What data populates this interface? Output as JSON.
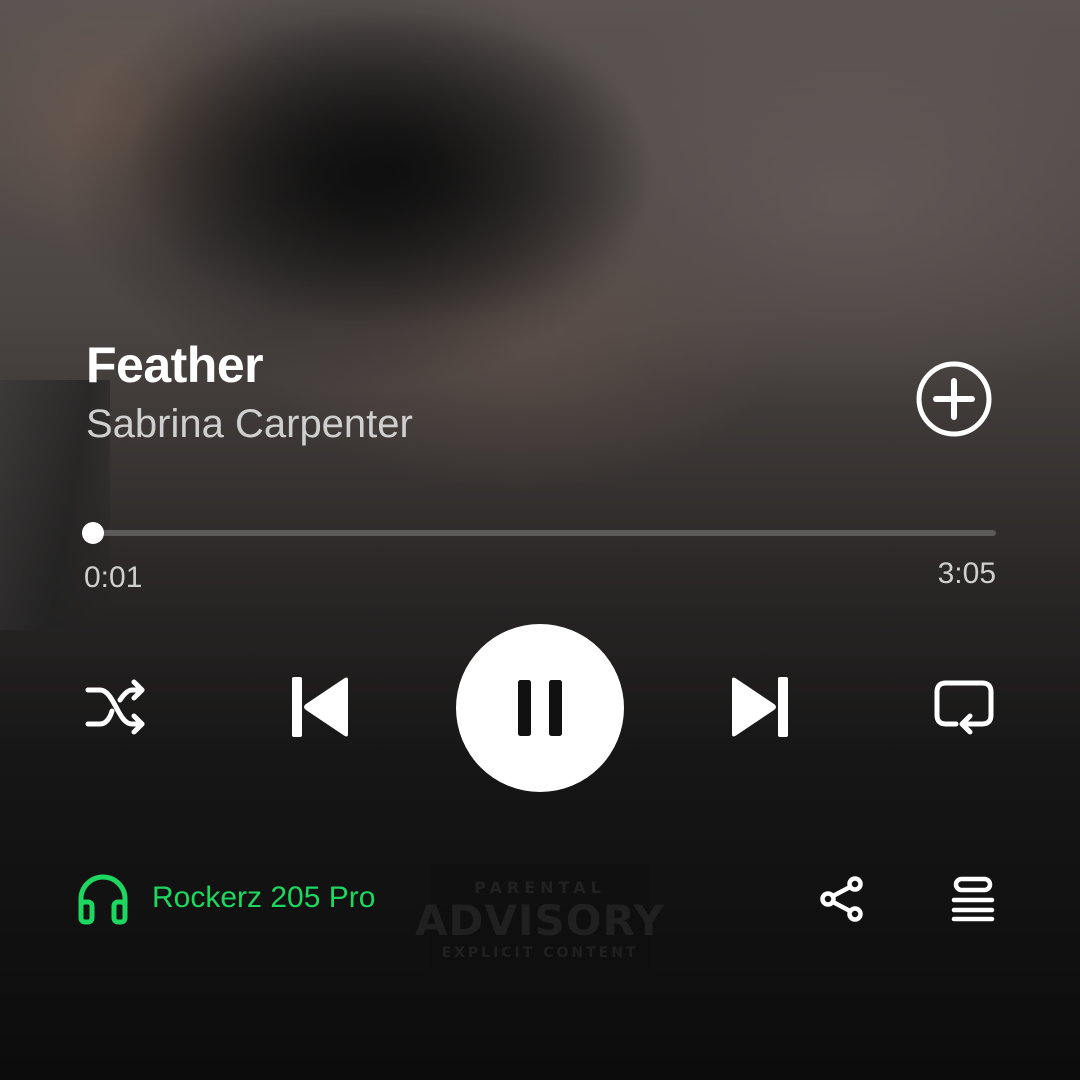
{
  "track": {
    "title": "Feather",
    "artist": "Sabrina Carpenter",
    "explicit_label": {
      "line1": "PARENTAL",
      "line2": "ADVISORY",
      "line3": "EXPLICIT CONTENT"
    }
  },
  "progress": {
    "elapsed": "0:01",
    "total": "3:05",
    "fraction": 0.005
  },
  "controls": {
    "add_icon": "plus-circle-icon",
    "shuffle_icon": "shuffle-icon",
    "previous_icon": "skip-previous-icon",
    "play_state": "playing",
    "play_pause_icon": "pause-icon",
    "next_icon": "skip-next-icon",
    "repeat_icon": "repeat-icon"
  },
  "footer": {
    "device_icon": "headphones-icon",
    "device_name": "Rockerz 205 Pro",
    "share_icon": "share-icon",
    "queue_icon": "queue-icon"
  },
  "colors": {
    "accent": "#1ed760",
    "text_primary": "#ffffff",
    "text_secondary": "#cfcfcf"
  }
}
